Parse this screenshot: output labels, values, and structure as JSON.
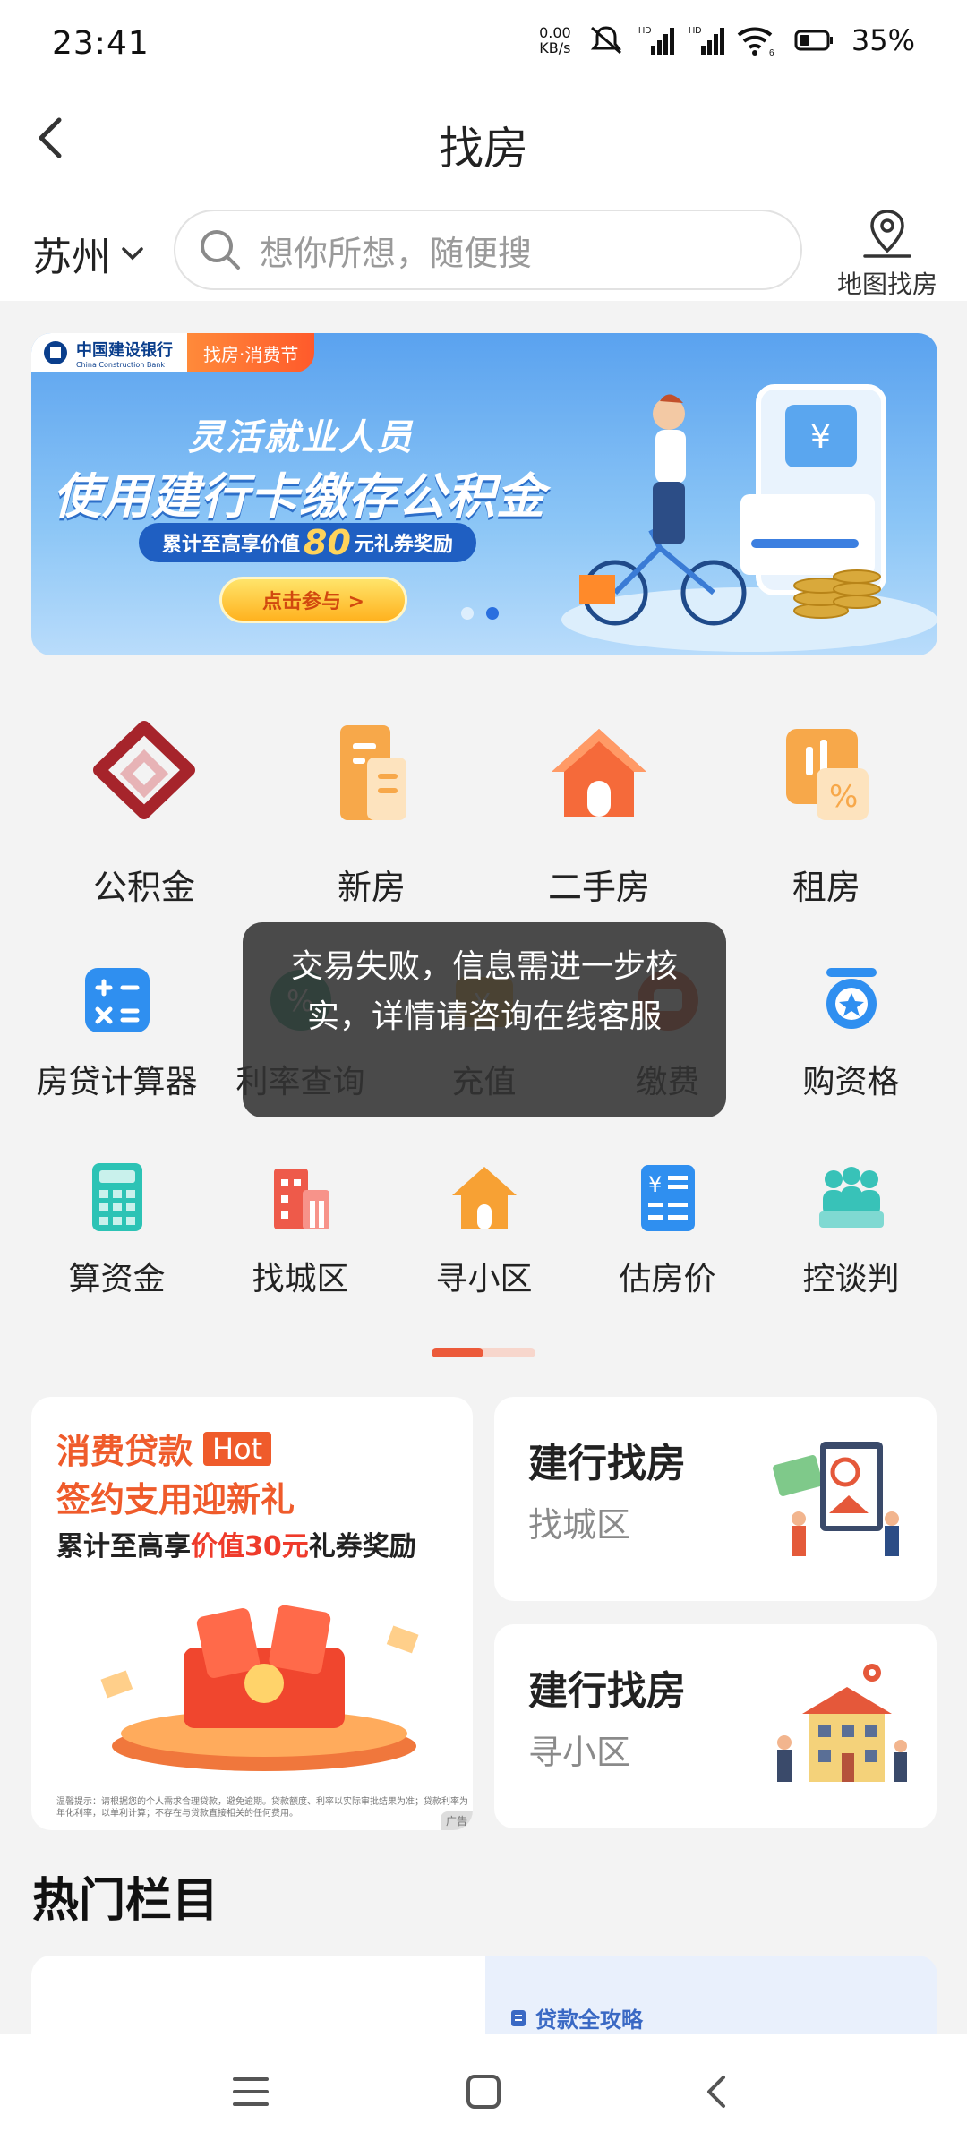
{
  "status_bar": {
    "time": "23:41",
    "net_speed_value": "0.00",
    "net_speed_unit": "KB/s",
    "signal1_label": "HD",
    "signal2_label": "HD",
    "wifi_label": "6",
    "battery": "35%"
  },
  "header": {
    "title": "找房",
    "city": "苏州",
    "search_placeholder": "想你所想，随便搜",
    "map_find_label": "地图找房"
  },
  "banner": {
    "bank_name": "中国建设银行",
    "bank_name_en": "China Construction Bank",
    "fest_tag": "找房·消费节",
    "line1": "灵活就业人员",
    "line2": "使用建行卡缴存公积金",
    "reward_prefix": "累计至高享价值",
    "reward_amount": "80",
    "reward_suffix": "元礼券奖励",
    "cta": "点击参与 >",
    "dots_total": 2,
    "dots_active": 2
  },
  "primary_grid": [
    {
      "label": "公积金",
      "icon": "fund-icon"
    },
    {
      "label": "新房",
      "icon": "new-house-icon"
    },
    {
      "label": "二手房",
      "icon": "second-hand-house-icon"
    },
    {
      "label": "租房",
      "icon": "rent-icon"
    }
  ],
  "grid_row2": [
    {
      "label": "房贷计算器",
      "icon": "calculator-icon"
    },
    {
      "label": "利率查询",
      "icon": "rate-icon"
    },
    {
      "label": "充值",
      "icon": "recharge-icon"
    },
    {
      "label": "缴费",
      "icon": "payment-icon"
    },
    {
      "label": "购资格",
      "icon": "qualification-icon"
    }
  ],
  "grid_row3": [
    {
      "label": "算资金",
      "icon": "funds-calc-icon"
    },
    {
      "label": "找城区",
      "icon": "district-icon"
    },
    {
      "label": "寻小区",
      "icon": "community-icon"
    },
    {
      "label": "估房价",
      "icon": "price-estimate-icon"
    },
    {
      "label": "控谈判",
      "icon": "negotiation-icon"
    }
  ],
  "pager": {
    "pages": 2,
    "current": 1
  },
  "loan_card": {
    "title": "消费贷款",
    "hot_badge": "Hot",
    "subtitle": "签约支用迎新礼",
    "reward_prefix": "累计至高享",
    "reward_highlight": "价值30元",
    "reward_suffix": "礼券奖励",
    "fine_print": "温馨提示：请根据您的个人需求合理贷款，避免逾期。贷款额度、利率以实际审批结果为准；贷款利率为年化利率，以单利计算；不存在与贷款直接相关的任何费用。",
    "ad_tag": "广告"
  },
  "find_cards": [
    {
      "title": "建行找房",
      "subtitle": "找城区"
    },
    {
      "title": "建行找房",
      "subtitle": "寻小区"
    }
  ],
  "hot_section": {
    "title": "热门栏目",
    "right_item": "贷款全攻略"
  },
  "toast": {
    "message": "交易失败，信息需进一步核实，详情请咨询在线客服"
  },
  "colors": {
    "accent": "#ef5b2b",
    "toast_bg": "#323232",
    "link_blue": "#3a69c4"
  }
}
